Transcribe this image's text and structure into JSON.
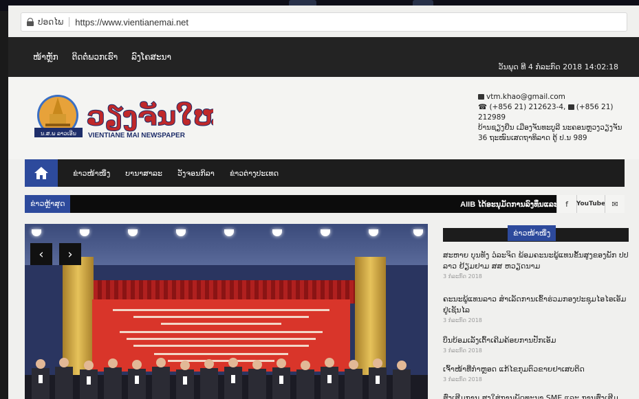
{
  "browser": {
    "secure_label": "ປອດໄພ",
    "url": "https://www.vientianemai.net"
  },
  "topnav": {
    "links": [
      "ໜ້າຫຼັກ",
      "ຕິດຕໍ່ພວກເຮົາ",
      "ລົງໂຄສະນາ"
    ],
    "date": "ວັນພຸດ ທີ 4 ກໍລະກົດ 2018 14:02:18"
  },
  "header": {
    "logo_title": "ວຽງຈັນໃໝ່",
    "logo_subtitle": "VIENTIANE MAI NEWSPAPER",
    "logo_badge": "ນ.ສ.ພ ລາວເອີນ",
    "email": "vtm.khao@gmail.com",
    "phone": "(+856 21) 212623-4,",
    "fax": "(+856 21) 212989",
    "address_1": "ບ້ານຊຽງຍືນ ເມືອງຈັນທະບູລີ ນະຄອນຫຼວງວຽງຈັນ",
    "address_2": "36 ຖະໜົນເສດຖາທິລາດ ຕູ້ ປ.ນ 989"
  },
  "mainnav": {
    "items": [
      "ຂ່າວໜ້າໜຶ່ງ",
      "ບານາສາລະ",
      "ວັງຈອນກິລາ",
      "ຂ່າວຕ່າງປະເທດ"
    ]
  },
  "ticker": {
    "label": "ຂ່າວຫຼ້າສຸດ",
    "text": "AIIB ໄດ້ອະນຸມັດການລົງທຶນແລະ",
    "social": [
      "f",
      "YouTube",
      "✉"
    ]
  },
  "sidebar": {
    "title": "ຂ່າວໜ້າໜຶ່ງ",
    "news": [
      {
        "title": "ສະຫາຍ ບຸນທັງ ວໍລະຈິດ ພ້ອມຄະນະພູ້ແທນຂັ້ນສູງຂອງພັກ ປປລາວ ຢ້ຽມຢາມ ສສ ຫວຽດນາມ",
        "meta": "3 ກໍລະກົດ 2018"
      },
      {
        "title": "ຄະນະພູ້ແທນລາວ ສຳເລັດການເຂົ້າຮ່ວມກອງປະຊຸມໄອໄອເອັມ ຢູ່ເຊັນໄລ",
        "meta": "3 ກໍລະກົດ 2018"
      },
      {
        "title": "ບຶນບ້ອມເລັງເຕົ້າເຄີມຄ້ອຍການປັກເອັມ",
        "meta": "3 ກໍລະກົດ 2018"
      },
      {
        "title": "ເຈົ້າໜ້າທີ່ກຳຫຼອດ ແກ້ໄຂກຸມຕົວຂາຍຢາເສບຕິດ",
        "meta": "3 ກໍລະກົດ 2018"
      },
      {
        "title": "ສົ່ງເສີມການ ສູງໃສ່ການພັດທະນາ SME ແລະ ການສົ່ງເສີມການ",
        "meta": ""
      }
    ]
  },
  "colors": {
    "accent": "#2d4a9c",
    "logo_red": "#c0282a",
    "nav_dark": "#1d1d1d"
  }
}
